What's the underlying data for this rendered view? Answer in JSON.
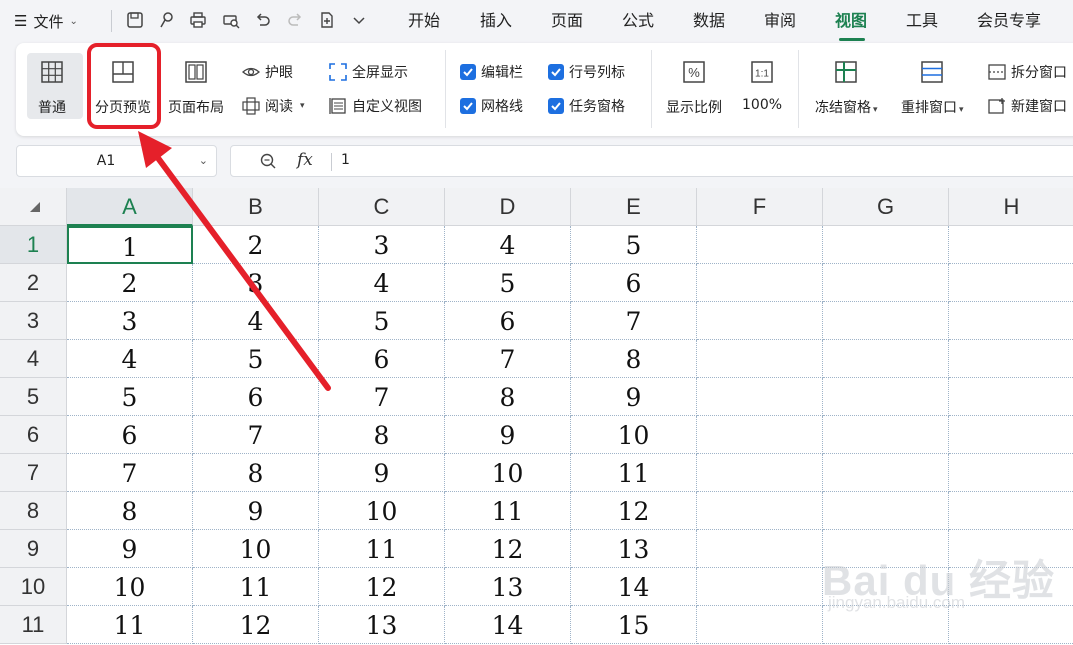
{
  "menu": {
    "file_label": "文件",
    "tabs": [
      "开始",
      "插入",
      "页面",
      "公式",
      "数据",
      "审阅",
      "视图",
      "工具",
      "会员专享"
    ],
    "active_tab": "视图"
  },
  "ribbon": {
    "normal": "普通",
    "page_break_preview": "分页预览",
    "page_layout": "页面布局",
    "eye_protect": "护眼",
    "reading": "阅读",
    "fullscreen": "全屏显示",
    "custom_view": "自定义视图",
    "edit_bar": "编辑栏",
    "row_col_headers": "行号列标",
    "gridlines": "网格线",
    "task_pane": "任务窗格",
    "zoom_ratio": "显示比例",
    "zoom_100": "100%",
    "freeze_panes": "冻结窗格",
    "arrange_windows": "重排窗口",
    "split_window": "拆分窗口",
    "new_window": "新建窗口",
    "one_to_one": "1:1"
  },
  "formula": {
    "cell_ref": "A1",
    "fx": "fx",
    "value": "1"
  },
  "sheet": {
    "columns": [
      "A",
      "B",
      "C",
      "D",
      "E",
      "F",
      "G",
      "H"
    ],
    "rows": [
      "1",
      "2",
      "3",
      "4",
      "5",
      "6",
      "7",
      "8",
      "9",
      "10",
      "11"
    ],
    "data": [
      [
        "1",
        "2",
        "3",
        "4",
        "5"
      ],
      [
        "2",
        "3",
        "4",
        "5",
        "6"
      ],
      [
        "3",
        "4",
        "5",
        "6",
        "7"
      ],
      [
        "4",
        "5",
        "6",
        "7",
        "8"
      ],
      [
        "5",
        "6",
        "7",
        "8",
        "9"
      ],
      [
        "6",
        "7",
        "8",
        "9",
        "10"
      ],
      [
        "7",
        "8",
        "9",
        "10",
        "11"
      ],
      [
        "8",
        "9",
        "10",
        "11",
        "12"
      ],
      [
        "9",
        "10",
        "11",
        "12",
        "13"
      ],
      [
        "10",
        "11",
        "12",
        "13",
        "14"
      ],
      [
        "11",
        "12",
        "13",
        "14",
        "15"
      ]
    ]
  },
  "watermark": {
    "line1": "Bai du 经验",
    "line2": "jingyan.baidu.com"
  },
  "colors": {
    "accent_green": "#1d8151",
    "highlight_red": "#e5202a",
    "checkbox_blue": "#1d6fe0"
  }
}
